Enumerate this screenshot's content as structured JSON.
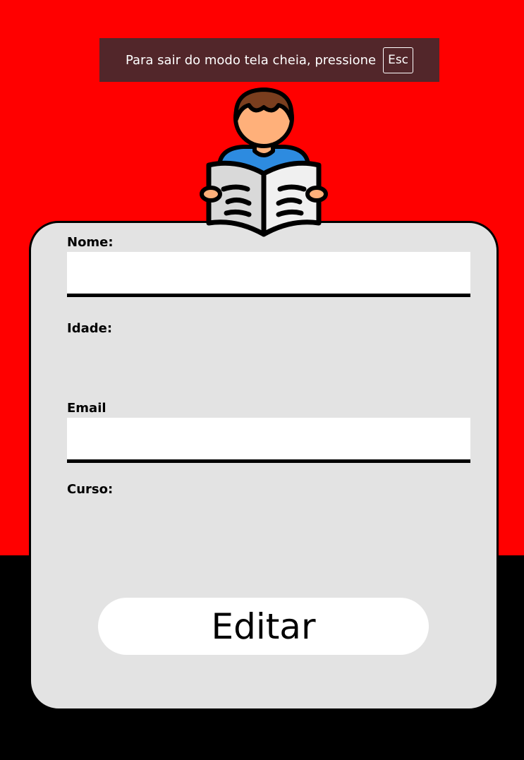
{
  "fullscreen_notice": {
    "text": "Para sair do modo tela cheia, pressione",
    "key": "Esc"
  },
  "form": {
    "nome_label": "Nome:",
    "idade_label": "Idade:",
    "email_label": "Email",
    "curso_label": "Curso:",
    "nome_value": "",
    "email_value": "",
    "submit_label": "Editar"
  },
  "icons": {
    "reader": "person-reading-newspaper-icon"
  },
  "colors": {
    "background_top": "#ff0000",
    "background_bottom": "#000000",
    "card": "#e3e3e3",
    "notice": "#52262a"
  }
}
